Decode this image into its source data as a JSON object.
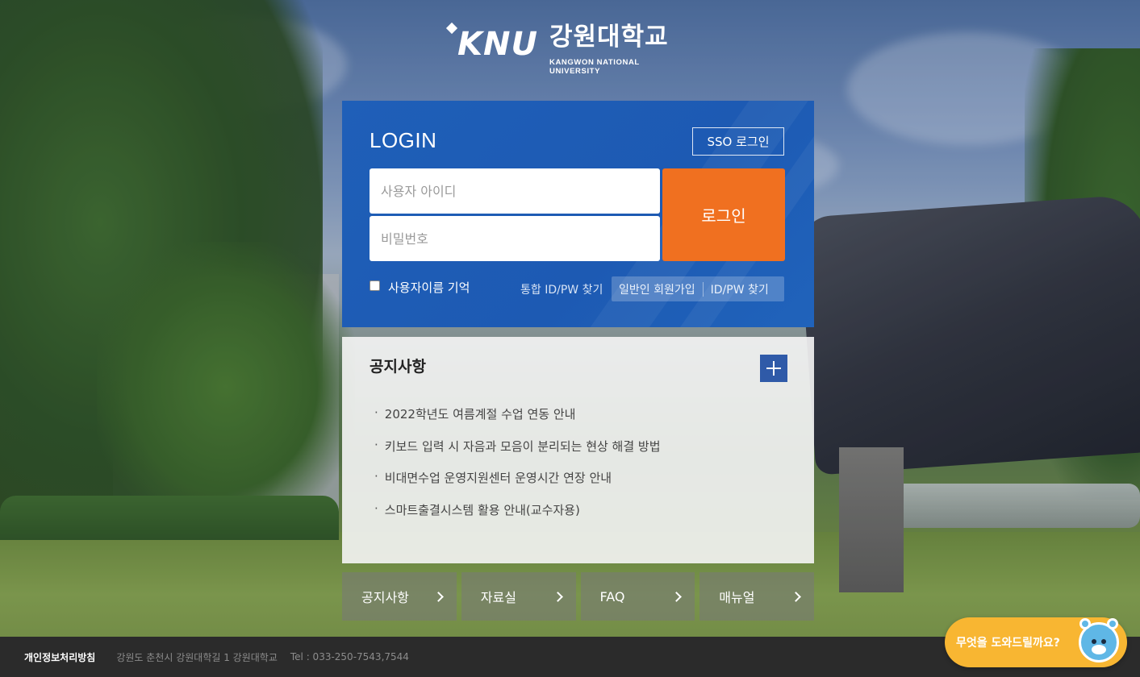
{
  "logo": {
    "mark_text": "KNU",
    "korean_name": "강원대학교",
    "english_name": "KANGWON NATIONAL UNIVERSITY"
  },
  "login": {
    "title": "LOGIN",
    "sso_label": "SSO 로그인",
    "id_placeholder": "사용자 아이디",
    "pw_placeholder": "비밀번호",
    "id_value": "",
    "pw_value": "",
    "login_button": "로그인",
    "remember_label": "사용자이름 기억",
    "remember_checked": false,
    "find_integrated": "통합 ID/PW 찾기",
    "join_general": "일반인 회원가입",
    "find_idpw": "ID/PW 찾기"
  },
  "notice": {
    "title": "공지사항",
    "bullet": "·",
    "items": [
      "2022학년도 여름계절 수업 연동 안내",
      "키보드 입력 시 자음과 모음이 분리되는 현상 해결 방법",
      "비대면수업 운영지원센터 운영시간 연장 안내",
      "스마트출결시스템 활용 안내(교수자용)"
    ]
  },
  "quick_menu": [
    "공지사항",
    "자료실",
    "FAQ",
    "매뉴얼"
  ],
  "footer": {
    "privacy": "개인정보처리방침",
    "address": "강원도 춘천시 강원대학길 1 강원대학교",
    "tel": "Tel : 033-250-7543,7544"
  },
  "chatbot": {
    "label": "무엇을 도와드릴까요?"
  },
  "colors": {
    "login_panel": "#1f5fb8",
    "login_button": "#f07020",
    "notice_more": "#2f5aa8",
    "footer": "#2b2b2b",
    "chatbot": "#f8b632"
  }
}
